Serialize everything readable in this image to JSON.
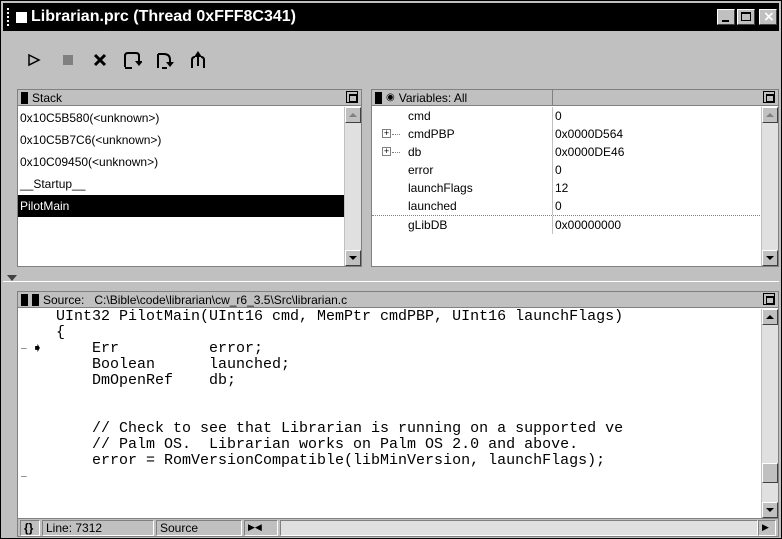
{
  "window": {
    "title": "Librarian.prc (Thread 0xFFF8C341)"
  },
  "toolbar": {
    "buttons": [
      {
        "name": "run-icon"
      },
      {
        "name": "stop-icon"
      },
      {
        "name": "kill-icon"
      },
      {
        "name": "step-over-icon"
      },
      {
        "name": "step-into-icon"
      },
      {
        "name": "step-out-icon"
      }
    ]
  },
  "stack": {
    "header": "Stack",
    "rows": [
      "0x10C5B580(<unknown>)",
      "0x10C5B7C6(<unknown>)",
      "0x10C09450(<unknown>)",
      "__Startup__",
      "PilotMain"
    ],
    "selected_index": 4
  },
  "variables": {
    "header": "Variables: All",
    "rows": [
      {
        "name": "cmd",
        "value": "0",
        "expandable": false
      },
      {
        "name": "cmdPBP",
        "value": "0x0000D564",
        "expandable": true
      },
      {
        "name": "db",
        "value": "0x0000DE46",
        "expandable": true
      },
      {
        "name": "error",
        "value": "0",
        "expandable": false
      },
      {
        "name": "launchFlags",
        "value": "12",
        "expandable": false
      },
      {
        "name": "launched",
        "value": "0",
        "expandable": false
      },
      {
        "name": "gLibDB",
        "value": "0x00000000",
        "expandable": false
      }
    ]
  },
  "source": {
    "label": "Source:",
    "path": "C:\\Bible\\code\\librarian\\cw_r6_3.5\\Src\\librarian.c",
    "lines": [
      {
        "text": "UInt32 PilotMain(UInt16 cmd, MemPtr cmdPBP, UInt16 launchFlags)",
        "dash": false,
        "arrow": false
      },
      {
        "text": "{",
        "dash": true,
        "arrow": true
      },
      {
        "text": "    Err          error;",
        "dash": false,
        "arrow": false
      },
      {
        "text": "    Boolean      launched;",
        "dash": false,
        "arrow": false
      },
      {
        "text": "    DmOpenRef    db;",
        "dash": false,
        "arrow": false
      },
      {
        "text": "",
        "dash": false,
        "arrow": false
      },
      {
        "text": "",
        "dash": false,
        "arrow": false
      },
      {
        "text": "    // Check to see that Librarian is running on a supported ve",
        "dash": false,
        "arrow": false
      },
      {
        "text": "    // Palm OS.  Librarian works on Palm OS 2.0 and above.",
        "dash": false,
        "arrow": false
      },
      {
        "text": "    error = RomVersionCompatible(libMinVersion, launchFlags);",
        "dash": true,
        "arrow": false
      }
    ]
  },
  "statusbar": {
    "line_label": "Line: 7312",
    "mode": "Source",
    "braces_icon": "{}"
  }
}
